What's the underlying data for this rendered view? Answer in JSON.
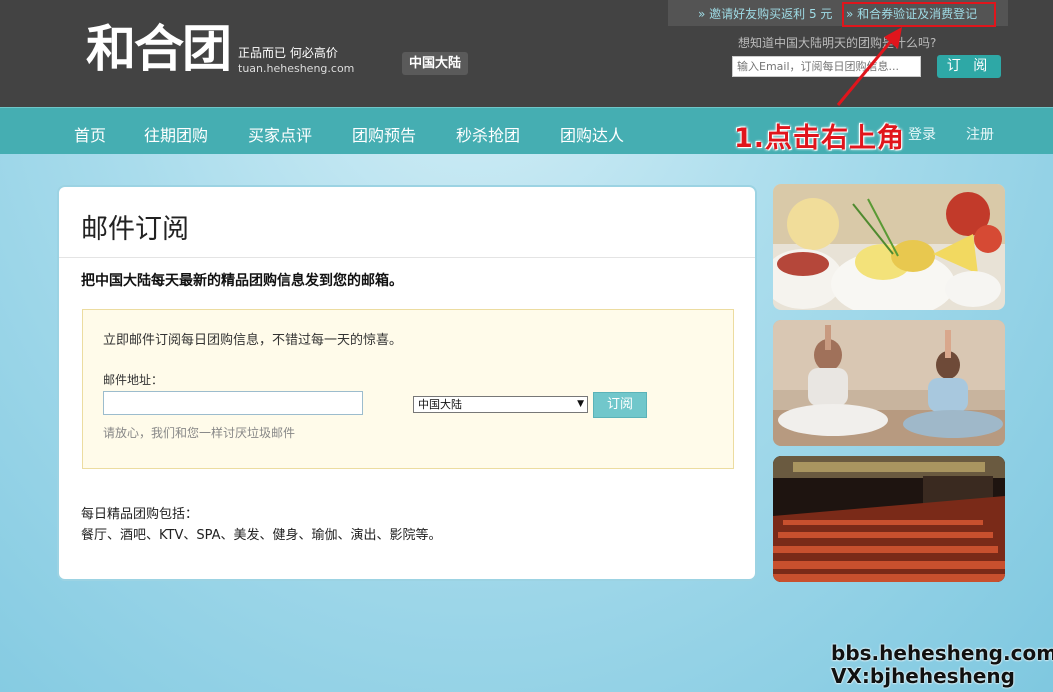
{
  "header": {
    "logo": "和合团",
    "slogan": "正品而已 何必高价",
    "site_url": "tuan.hehesheng.com",
    "region": "中国大陆",
    "invite_link": "» 邀请好友购买返利 5 元",
    "verify_link": "» 和合券验证及消费登记",
    "sub_question": "想知道中国大陆明天的团购是什么吗?",
    "email_placeholder": "输入Email，订阅每日团购信息...",
    "subscribe_label": "订 阅"
  },
  "nav": {
    "items": [
      "首页",
      "往期团购",
      "买家点评",
      "团购预告",
      "秒杀抢团",
      "团购达人"
    ],
    "login": "登录",
    "register": "注册"
  },
  "annotation": "1.点击右上角",
  "main": {
    "title": "邮件订阅",
    "intro": "把中国大陆每天最新的精品团购信息发到您的邮箱。",
    "form": {
      "lead": "立即邮件订阅每日团购信息，不错过每一天的惊喜。",
      "email_label": "邮件地址：",
      "city_selected": "中国大陆",
      "submit_label": "订阅",
      "note": "请放心，我们和您一样讨厌垃圾邮件"
    },
    "categories_title": "每日精品团购包括：",
    "categories_list": "餐厅、酒吧、KTV、SPA、美发、健身、瑜伽、演出、影院等。"
  },
  "side_images": [
    "food-photo",
    "yoga-photo",
    "theater-photo"
  ],
  "watermark": {
    "line1": "bbs.hehesheng.com",
    "line2": "VX:bjhehesheng"
  },
  "colors": {
    "header_bg": "#434343",
    "nav_bg": "#45aeb2",
    "accent_red": "#e0151c",
    "button_teal": "#2ea8a6"
  }
}
